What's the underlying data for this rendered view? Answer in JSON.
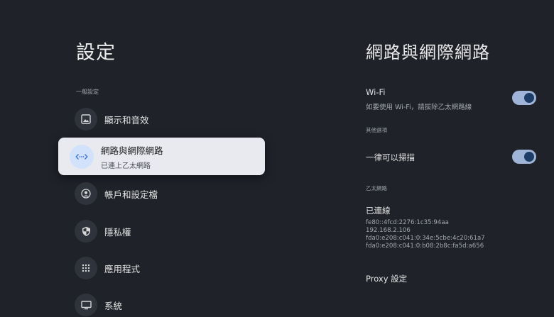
{
  "left": {
    "title": "設定",
    "section_label": "一般設定",
    "items": [
      {
        "label": "顯示和音效",
        "icon": "image-icon"
      },
      {
        "label": "網路與網際網路",
        "sub": "已連上乙太網路",
        "icon": "network-code-icon",
        "selected": true
      },
      {
        "label": "帳戶和設定檔",
        "icon": "account-icon"
      },
      {
        "label": "隱私權",
        "icon": "shield-icon"
      },
      {
        "label": "應用程式",
        "icon": "apps-grid-icon"
      },
      {
        "label": "系統",
        "icon": "tv-icon"
      }
    ]
  },
  "right": {
    "title": "網路與網際網路",
    "wifi": {
      "title": "Wi-Fi",
      "sub": "如要使用 Wi-Fi，請拔除乙太網路線",
      "toggle_on": true
    },
    "other_options_label": "其他選項",
    "always_scan": {
      "title": "一律可以掃描",
      "toggle_on": true
    },
    "ethernet_label": "乙太網路",
    "connected": {
      "title": "已連線",
      "addresses": [
        "fe80::4fcd:2276:1c35:94aa",
        "192.168.2.106",
        "fda0:e208:c041:0:34e:5cbe:4c20:61a7",
        "fda0:e208:c041:0:b08:2b8c:fa5d:a656"
      ]
    },
    "proxy": {
      "title": "Proxy 設定"
    }
  },
  "colors": {
    "background": "#1f2229",
    "selected_card": "#e8eaef",
    "toggle_track": "#9fb4d6",
    "toggle_knob": "#1d3c66"
  }
}
